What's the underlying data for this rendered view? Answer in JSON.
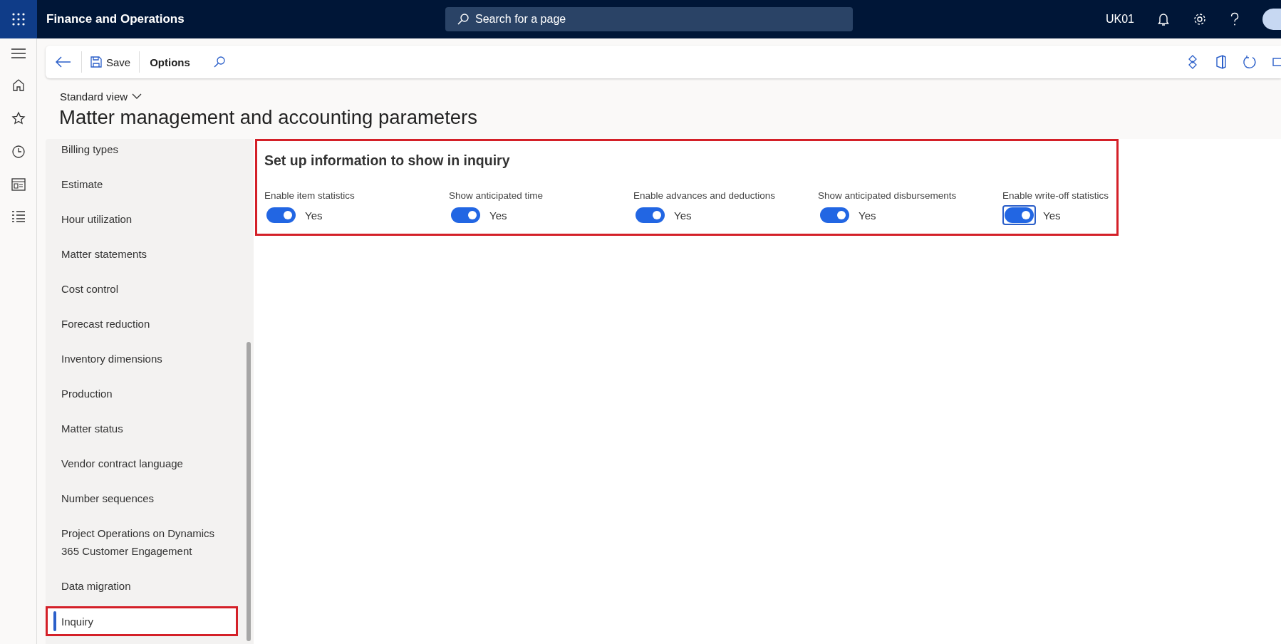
{
  "app": {
    "title": "Finance and Operations",
    "search_placeholder": "Search for a page",
    "company": "UK01"
  },
  "toolbar": {
    "save": "Save",
    "options": "Options"
  },
  "page": {
    "view": "Standard view",
    "title": "Matter management and accounting parameters"
  },
  "nav": [
    {
      "label": "Billing types",
      "selected": false
    },
    {
      "label": "Estimate",
      "selected": false
    },
    {
      "label": "Hour utilization",
      "selected": false
    },
    {
      "label": "Matter statements",
      "selected": false
    },
    {
      "label": "Cost control",
      "selected": false
    },
    {
      "label": "Forecast reduction",
      "selected": false
    },
    {
      "label": "Inventory dimensions",
      "selected": false
    },
    {
      "label": "Production",
      "selected": false
    },
    {
      "label": "Matter status",
      "selected": false
    },
    {
      "label": "Vendor contract language",
      "selected": false
    },
    {
      "label": "Number sequences",
      "selected": false
    },
    {
      "label": "Project Operations on Dynamics 365 Customer Engagement",
      "selected": false
    },
    {
      "label": "Data migration",
      "selected": false
    },
    {
      "label": "Inquiry",
      "selected": true
    }
  ],
  "section": {
    "title": "Set up information to show in inquiry",
    "fields": [
      {
        "label": "Enable item statistics",
        "on": true,
        "value": "Yes",
        "focused": false
      },
      {
        "label": "Show anticipated time",
        "on": true,
        "value": "Yes",
        "focused": false
      },
      {
        "label": "Enable advances and deductions",
        "on": true,
        "value": "Yes",
        "focused": false
      },
      {
        "label": "Show anticipated disbursements",
        "on": true,
        "value": "Yes",
        "focused": false
      },
      {
        "label": "Enable write-off statistics",
        "on": true,
        "value": "Yes",
        "focused": true
      }
    ]
  }
}
